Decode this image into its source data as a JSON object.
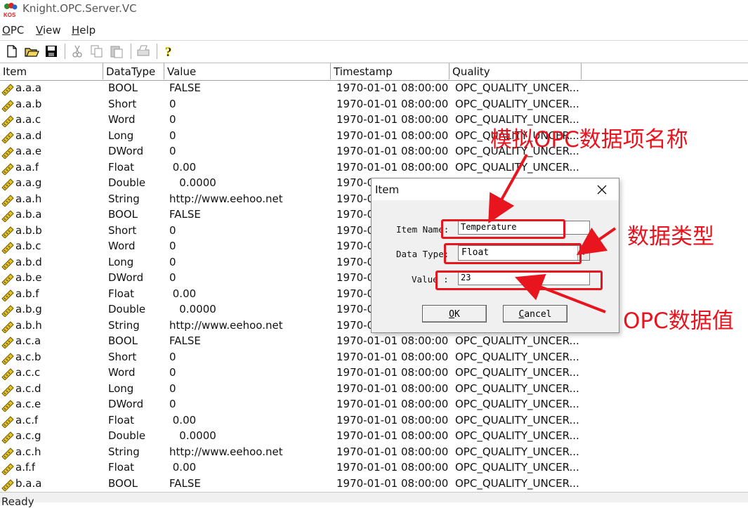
{
  "window": {
    "title": "Knight.OPC.Server.VC"
  },
  "menu": [
    "OPC",
    "View",
    "Help"
  ],
  "toolbar": [
    "new-file-icon",
    "open-folder-icon",
    "save-icon",
    "cut-icon",
    "copy-icon",
    "paste-icon",
    "print-icon",
    "help-icon"
  ],
  "columns": [
    "Item",
    "DataType",
    "Value",
    "Timestamp",
    "Quality"
  ],
  "rows": [
    {
      "item": "a.a.a",
      "type": "BOOL",
      "value": "FALSE",
      "ts": "1970-01-01 08:00:00",
      "quality": "OPC_QUALITY_UNCER..."
    },
    {
      "item": "a.a.b",
      "type": "Short",
      "value": "0",
      "ts": "1970-01-01 08:00:00",
      "quality": "OPC_QUALITY_UNCER..."
    },
    {
      "item": "a.a.c",
      "type": "Word",
      "value": "0",
      "ts": "1970-01-01 08:00:00",
      "quality": "OPC_QUALITY_UNCER..."
    },
    {
      "item": "a.a.d",
      "type": "Long",
      "value": "0",
      "ts": "1970-01-01 08:00:00",
      "quality": "OPC_QUALITY_UNCER..."
    },
    {
      "item": "a.a.e",
      "type": "DWord",
      "value": "0",
      "ts": "1970-01-01 08:00:00",
      "quality": "OPC_QUALITY_UNCER..."
    },
    {
      "item": "a.a.f",
      "type": "Float",
      "value": " 0.00",
      "ts": "1970-01-01 08:00:00",
      "quality": "OPC_QUALITY_UNCER..."
    },
    {
      "item": "a.a.g",
      "type": "Double",
      "value": "   0.0000",
      "ts": "1970-0",
      "quality": ""
    },
    {
      "item": "a.a.h",
      "type": "String",
      "value": "http://www.eehoo.net",
      "ts": "1970-0",
      "quality": ""
    },
    {
      "item": "a.b.a",
      "type": "BOOL",
      "value": "FALSE",
      "ts": "1970-0",
      "quality": ""
    },
    {
      "item": "a.b.b",
      "type": "Short",
      "value": "0",
      "ts": "1970-0",
      "quality": ""
    },
    {
      "item": "a.b.c",
      "type": "Word",
      "value": "0",
      "ts": "1970-0",
      "quality": ""
    },
    {
      "item": "a.b.d",
      "type": "Long",
      "value": "0",
      "ts": "1970-0",
      "quality": ""
    },
    {
      "item": "a.b.e",
      "type": "DWord",
      "value": "0",
      "ts": "1970-0",
      "quality": ""
    },
    {
      "item": "a.b.f",
      "type": "Float",
      "value": " 0.00",
      "ts": "1970-0",
      "quality": ""
    },
    {
      "item": "a.b.g",
      "type": "Double",
      "value": "   0.0000",
      "ts": "1970-0",
      "quality": ""
    },
    {
      "item": "a.b.h",
      "type": "String",
      "value": "http://www.eehoo.net",
      "ts": "1970-0",
      "quality": ""
    },
    {
      "item": "a.c.a",
      "type": "BOOL",
      "value": "FALSE",
      "ts": "1970-01-01 08:00:00",
      "quality": "OPC_QUALITY_UNCER..."
    },
    {
      "item": "a.c.b",
      "type": "Short",
      "value": "0",
      "ts": "1970-01-01 08:00:00",
      "quality": "OPC_QUALITY_UNCER..."
    },
    {
      "item": "a.c.c",
      "type": "Word",
      "value": "0",
      "ts": "1970-01-01 08:00:00",
      "quality": "OPC_QUALITY_UNCER..."
    },
    {
      "item": "a.c.d",
      "type": "Long",
      "value": "0",
      "ts": "1970-01-01 08:00:00",
      "quality": "OPC_QUALITY_UNCER..."
    },
    {
      "item": "a.c.e",
      "type": "DWord",
      "value": "0",
      "ts": "1970-01-01 08:00:00",
      "quality": "OPC_QUALITY_UNCER..."
    },
    {
      "item": "a.c.f",
      "type": "Float",
      "value": " 0.00",
      "ts": "1970-01-01 08:00:00",
      "quality": "OPC_QUALITY_UNCER..."
    },
    {
      "item": "a.c.g",
      "type": "Double",
      "value": "   0.0000",
      "ts": "1970-01-01 08:00:00",
      "quality": "OPC_QUALITY_UNCER..."
    },
    {
      "item": "a.c.h",
      "type": "String",
      "value": "http://www.eehoo.net",
      "ts": "1970-01-01 08:00:00",
      "quality": "OPC_QUALITY_UNCER..."
    },
    {
      "item": "a.f.f",
      "type": "Float",
      "value": " 0.00",
      "ts": "1970-01-01 08:00:00",
      "quality": "OPC_QUALITY_UNCER..."
    },
    {
      "item": "b.a.a",
      "type": "BOOL",
      "value": "FALSE",
      "ts": "1970-01-01 08:00:00",
      "quality": "OPC_QUALITY_UNCER..."
    }
  ],
  "status": "Ready",
  "dialog": {
    "title": "Item",
    "name_label": "Item Name:",
    "name_value": "Temperature",
    "type_label": "Data Type:",
    "type_value": "Float",
    "value_label": "Value :",
    "value_value": "23",
    "ok": "OK",
    "cancel": "Cancel"
  },
  "annotations": {
    "name": "模拟OPC数据项名称",
    "type": "数据类型",
    "value": "OPC数据值",
    "color": "#e8141e"
  }
}
